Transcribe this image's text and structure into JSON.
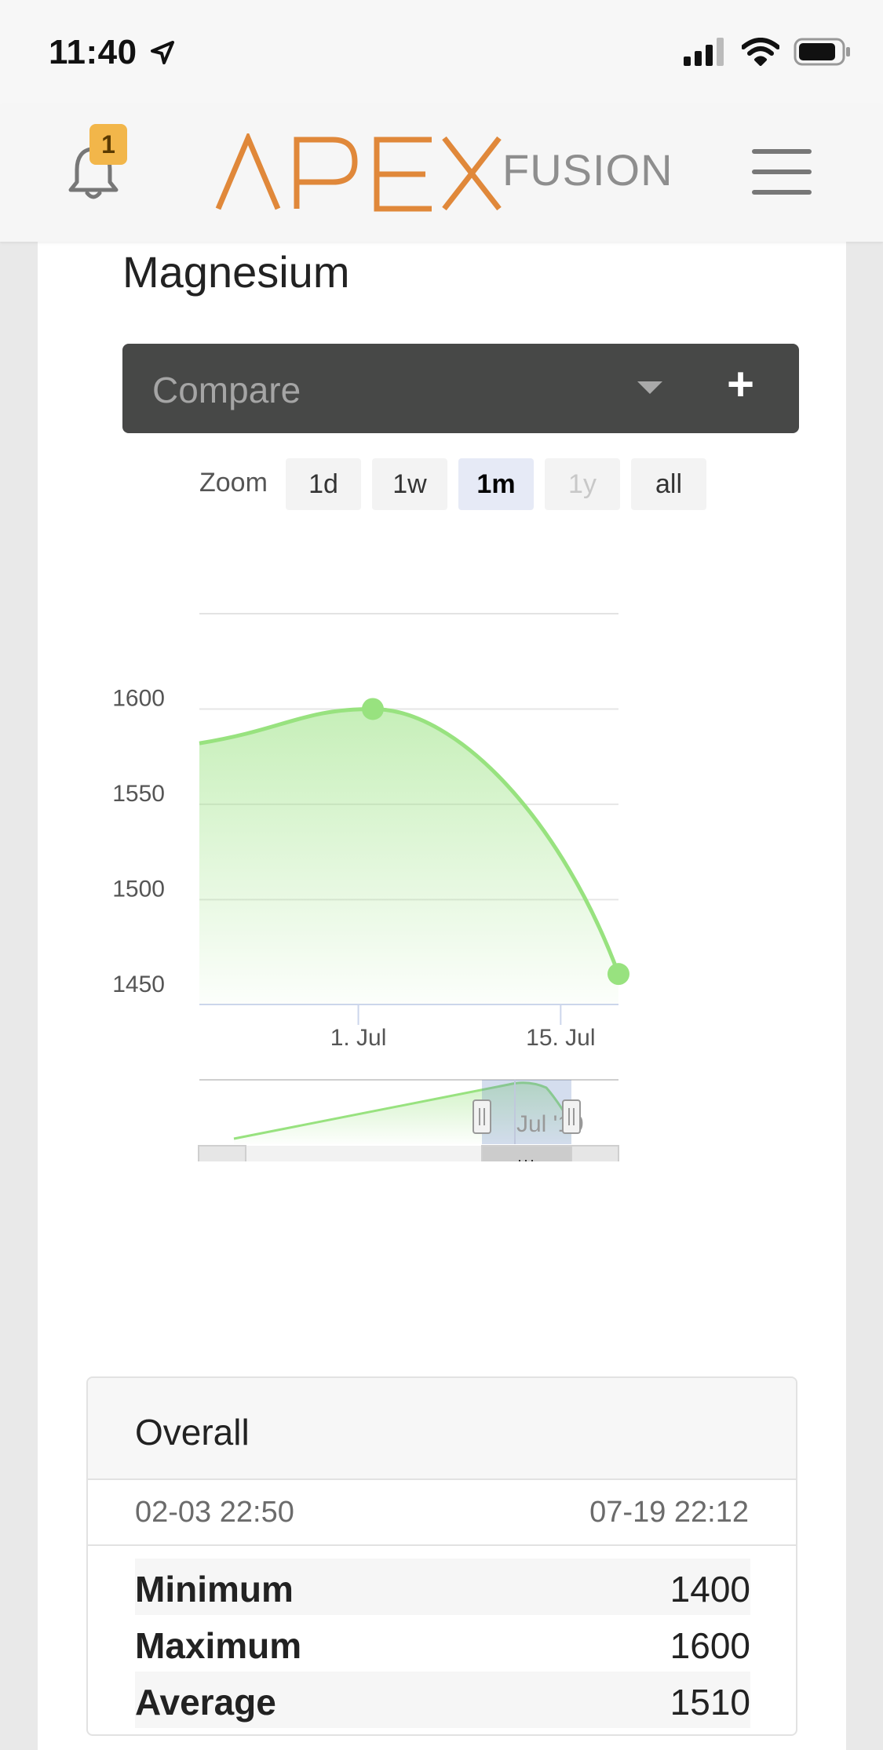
{
  "status_bar": {
    "time": "11:40",
    "location_icon": "location-arrow-icon",
    "signal_icon": "cellular-signal-icon",
    "wifi_icon": "wifi-icon",
    "battery_icon": "battery-icon"
  },
  "header": {
    "notification_count": "1",
    "logo_apex": "APEX",
    "logo_fusion": "FUSION",
    "brand_color": "#e0883a",
    "menu_icon": "hamburger-menu-icon"
  },
  "card": {
    "title": "Magnesium",
    "compare": {
      "placeholder": "Compare",
      "add_label": "+"
    },
    "zoom": {
      "label": "Zoom",
      "buttons": [
        {
          "label": "1d",
          "state": "normal"
        },
        {
          "label": "1w",
          "state": "normal"
        },
        {
          "label": "1m",
          "state": "active"
        },
        {
          "label": "1y",
          "state": "disabled"
        },
        {
          "label": "all",
          "state": "normal"
        }
      ]
    }
  },
  "chart_data": {
    "type": "area",
    "title": "",
    "xlabel": "",
    "ylabel": "",
    "series_color": "#98e27f",
    "x_ticks": [
      "1. Jul",
      "15. Jul"
    ],
    "y_ticks": [
      1450,
      1500,
      1550,
      1600
    ],
    "ylim": [
      1445,
      1650
    ],
    "grid": true,
    "points": [
      {
        "x": "2019-06-20",
        "y": 1582
      },
      {
        "x": "2019-07-02",
        "y": 1600
      },
      {
        "x": "2019-07-19",
        "y": 1461
      }
    ],
    "markers": [
      {
        "x": "2019-07-02",
        "y": 1600
      },
      {
        "x": "2019-07-19",
        "y": 1461
      }
    ],
    "navigator": {
      "label": "Jul '19",
      "selected_range": [
        "2019-06-19",
        "2019-07-19"
      ]
    }
  },
  "overall": {
    "title": "Overall",
    "range_start": "02-03 22:50",
    "range_end": "07-19 22:12",
    "stats": [
      {
        "name": "Minimum",
        "value": "1400"
      },
      {
        "name": "Maximum",
        "value": "1600"
      },
      {
        "name": "Average",
        "value": "1510"
      }
    ]
  }
}
